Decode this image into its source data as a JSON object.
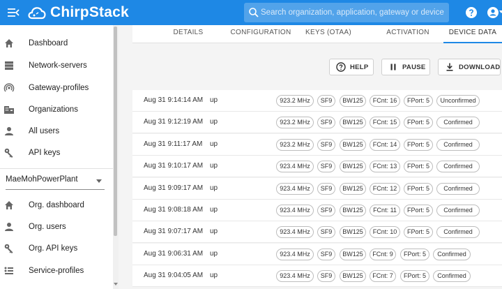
{
  "app": {
    "brand": "ChirpStack"
  },
  "search": {
    "placeholder": "Search organization, application, gateway or device"
  },
  "sidebar": {
    "items": [
      {
        "label": "Dashboard",
        "icon": "home-icon"
      },
      {
        "label": "Network-servers",
        "icon": "server-icon"
      },
      {
        "label": "Gateway-profiles",
        "icon": "wifi-icon"
      },
      {
        "label": "Organizations",
        "icon": "building-icon"
      },
      {
        "label": "All users",
        "icon": "user-icon"
      },
      {
        "label": "API keys",
        "icon": "key-icon"
      }
    ],
    "org_select": {
      "value": "MaeMohPowerPlant"
    },
    "org_items": [
      {
        "label": "Org. dashboard",
        "icon": "home-icon"
      },
      {
        "label": "Org. users",
        "icon": "user-icon"
      },
      {
        "label": "Org. API keys",
        "icon": "key-icon"
      },
      {
        "label": "Service-profiles",
        "icon": "list-icon"
      }
    ]
  },
  "tabs": [
    {
      "label": "DETAILS",
      "active": false
    },
    {
      "label": "CONFIGURATION",
      "active": false
    },
    {
      "label": "KEYS (OTAA)",
      "active": false
    },
    {
      "label": "ACTIVATION",
      "active": false
    },
    {
      "label": "DEVICE DATA",
      "active": true
    }
  ],
  "toolbar": {
    "help_label": "HELP",
    "pause_label": "PAUSE",
    "download_label": "DOWNLOAD"
  },
  "frames": [
    {
      "time": "Aug 31 9:14:14 AM",
      "dir": "up",
      "freq": "923.2 MHz",
      "sf": "SF9",
      "bw": "BW125",
      "fcnt": "FCnt: 16",
      "fport": "FPort: 5",
      "conf": "Unconfirmed"
    },
    {
      "time": "Aug 31 9:12:19 AM",
      "dir": "up",
      "freq": "923.2 MHz",
      "sf": "SF9",
      "bw": "BW125",
      "fcnt": "FCnt: 15",
      "fport": "FPort: 5",
      "conf": "Confirmed"
    },
    {
      "time": "Aug 31 9:11:17 AM",
      "dir": "up",
      "freq": "923.2 MHz",
      "sf": "SF9",
      "bw": "BW125",
      "fcnt": "FCnt: 14",
      "fport": "FPort: 5",
      "conf": "Confirmed"
    },
    {
      "time": "Aug 31 9:10:17 AM",
      "dir": "up",
      "freq": "923.4 MHz",
      "sf": "SF9",
      "bw": "BW125",
      "fcnt": "FCnt: 13",
      "fport": "FPort: 5",
      "conf": "Confirmed"
    },
    {
      "time": "Aug 31 9:09:17 AM",
      "dir": "up",
      "freq": "923.4 MHz",
      "sf": "SF9",
      "bw": "BW125",
      "fcnt": "FCnt: 12",
      "fport": "FPort: 5",
      "conf": "Confirmed"
    },
    {
      "time": "Aug 31 9:08:18 AM",
      "dir": "up",
      "freq": "923.4 MHz",
      "sf": "SF9",
      "bw": "BW125",
      "fcnt": "FCnt: 11",
      "fport": "FPort: 5",
      "conf": "Confirmed"
    },
    {
      "time": "Aug 31 9:07:17 AM",
      "dir": "up",
      "freq": "923.4 MHz",
      "sf": "SF9",
      "bw": "BW125",
      "fcnt": "FCnt: 10",
      "fport": "FPort: 5",
      "conf": "Confirmed"
    },
    {
      "time": "Aug 31 9:06:31 AM",
      "dir": "up",
      "freq": "923.4 MHz",
      "sf": "SF9",
      "bw": "BW125",
      "fcnt": "FCnt: 9",
      "fport": "FPort: 5",
      "conf": "Confirmed"
    },
    {
      "time": "Aug 31 9:04:05 AM",
      "dir": "up",
      "freq": "923.4 MHz",
      "sf": "SF9",
      "bw": "BW125",
      "fcnt": "FCnt: 7",
      "fport": "FPort: 5",
      "conf": "Confirmed"
    }
  ]
}
